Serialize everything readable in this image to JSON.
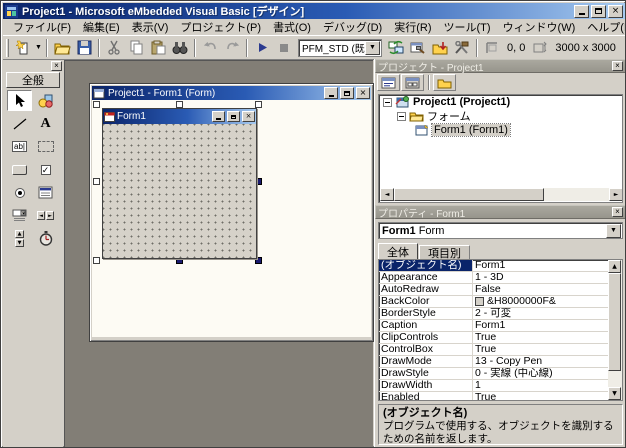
{
  "window": {
    "title": "Project1 - Microsoft eMbedded Visual Basic [デザイン]"
  },
  "menu": {
    "items": [
      "ファイル(F)",
      "編集(E)",
      "表示(V)",
      "プロジェクト(P)",
      "書式(O)",
      "デバッグ(D)",
      "実行(R)",
      "ツール(T)",
      "ウィンドウ(W)",
      "ヘルプ(H)"
    ]
  },
  "toolbar": {
    "device_combo_value": "PFM_STD (既",
    "position_value": "0, 0",
    "size_value": "3000 x 3000",
    "icons": [
      "new-project",
      "open",
      "save",
      "cut",
      "copy",
      "paste",
      "find",
      "undo",
      "redo",
      "run",
      "stop",
      "device-sync",
      "control-manager",
      "download",
      "remote-tools",
      "position-indicator",
      "size-indicator"
    ]
  },
  "toolbox": {
    "tab_label": "全般",
    "tools": [
      "pointer",
      "picturebox",
      "line",
      "label",
      "textbox",
      "frame",
      "commandbutton",
      "checkbox",
      "optionbutton",
      "listbox",
      "combobox",
      "hscrollbar",
      "vscrollbar",
      "timer"
    ]
  },
  "designer": {
    "window_title": "Project1 - Form1 (Form)",
    "form_caption": "Form1"
  },
  "project_panel": {
    "title": "プロジェクト - Project1",
    "toolbar_icons": [
      "view-code",
      "view-object",
      "toggle-folders"
    ],
    "tree": {
      "root_label": "Project1 (Project1)",
      "folder_label": "フォーム",
      "form_label": "Form1 (Form1)"
    }
  },
  "properties_panel": {
    "title": "プロパティ - Form1",
    "selector_object": "Form1",
    "selector_type": "Form",
    "tabs": [
      "全体",
      "項目別"
    ],
    "rows": [
      {
        "name": "(オブジェクト名)",
        "value": "Form1",
        "selected": true
      },
      {
        "name": "Appearance",
        "value": "1 - 3D"
      },
      {
        "name": "AutoRedraw",
        "value": "False"
      },
      {
        "name": "BackColor",
        "value": "&H8000000F&",
        "swatch": true
      },
      {
        "name": "BorderStyle",
        "value": "2 - 可変"
      },
      {
        "name": "Caption",
        "value": "Form1"
      },
      {
        "name": "ClipControls",
        "value": "True"
      },
      {
        "name": "ControlBox",
        "value": "True"
      },
      {
        "name": "DrawMode",
        "value": "13 - Copy Pen"
      },
      {
        "name": "DrawStyle",
        "value": "0 - 実線 (中心線)"
      },
      {
        "name": "DrawWidth",
        "value": "1"
      },
      {
        "name": "Enabled",
        "value": "True"
      }
    ],
    "description_title": "(オブジェクト名)",
    "description_text": "プログラムで使用する、オブジェクトを識別するための名前を返します。"
  },
  "colors": {
    "titlebar_start": "#0a246a",
    "titlebar_end": "#a6caf0",
    "chrome": "#d4d0c8",
    "mdi_background": "#827e76",
    "selection_navy": "#0a246a"
  }
}
